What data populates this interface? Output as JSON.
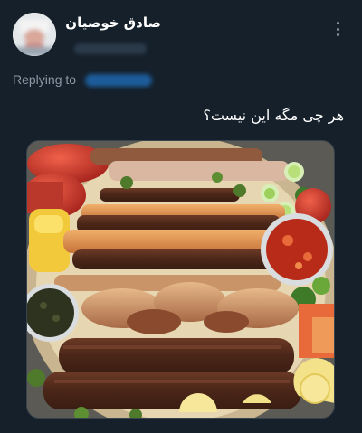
{
  "author": {
    "display_name": "صادق خوصیان"
  },
  "reply": {
    "prefix": "Replying to"
  },
  "tweet": {
    "text": "هر چی مگه این نیست؟"
  },
  "icons": {
    "more": "more-options-icon",
    "avatar": "user-avatar"
  },
  "colors": {
    "background": "#15202b",
    "secondary_text": "#8b98a5",
    "link": "#1d9bf0"
  }
}
